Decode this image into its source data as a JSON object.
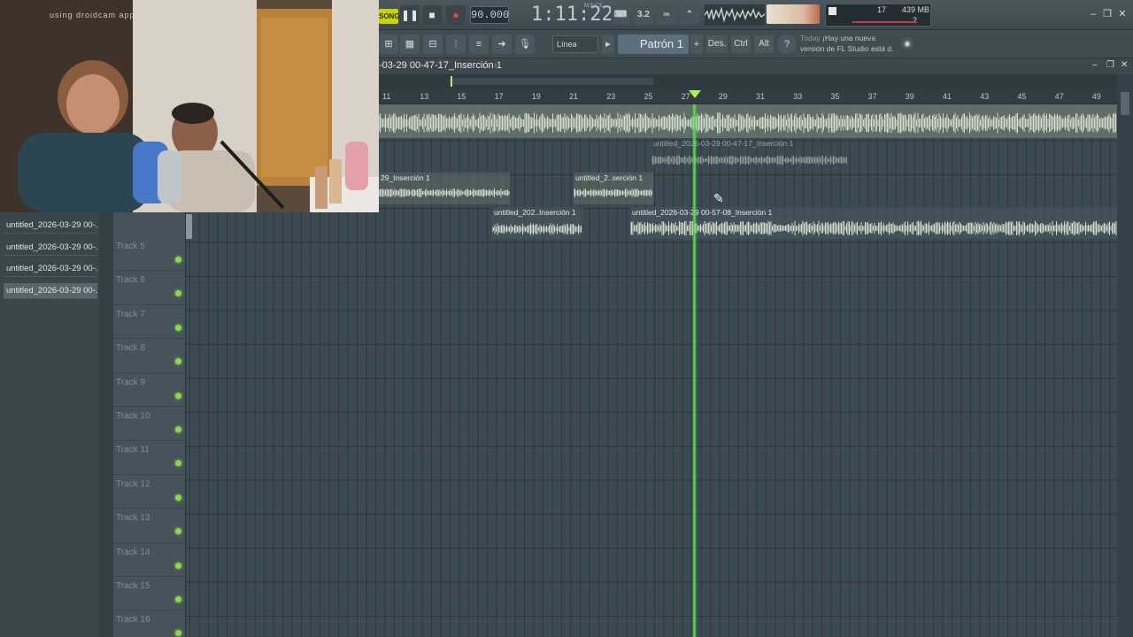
{
  "transport": {
    "song_label": "SONG",
    "tempo": "90.000",
    "time": "1:11:22",
    "time_unit": "M:S:CS",
    "cpu_value": "17",
    "memory": "439 MB",
    "voices": "2"
  },
  "toolbar": {
    "snap_label": "Línea",
    "pattern_label": "Patrón 1",
    "desc_label": "Des.",
    "ctrl_label": "Ctrl",
    "alt_label": "Alt",
    "news_today": "Today",
    "news_line1": "¡Hay una nueva",
    "news_line2": "versión de FL Studio está d."
  },
  "playlist": {
    "title": "-03-29 00-47-17_Inserción 1",
    "ruler_ticks": [
      "11",
      "13",
      "15",
      "17",
      "19",
      "21",
      "23",
      "25",
      "27",
      "29",
      "31",
      "33",
      "35",
      "37",
      "39",
      "41",
      "43",
      "45",
      "47",
      "49"
    ]
  },
  "clips": [
    {
      "label": "untitled_2026-03-29 00-47-17_Inserción 1"
    },
    {
      "label": "29_Inserción 1"
    },
    {
      "label": "untitled_2..serción 1"
    },
    {
      "label": "untitled_202..Inserción 1"
    },
    {
      "label": "untitled_2026-03-29 00-57-08_Inserción 1"
    }
  ],
  "tracks": [
    "Track 5",
    "Track 6",
    "Track 7",
    "Track 8",
    "Track 9",
    "Track 10",
    "Track 11",
    "Track 12",
    "Track 13",
    "Track 14",
    "Track 15",
    "Track 16"
  ],
  "browser": {
    "items": [
      "untitled_2026-03-29 00-...",
      "untitled_2026-03-29 00-...",
      "untitled_2026-03-29 00-...",
      "untitled_2026-03-29 00-..."
    ]
  },
  "webcam": {
    "overlay_text": "using droidcam app"
  },
  "colors": {
    "playhead": "#5ee24a",
    "song_button": "#c8d400",
    "record": "#ff3d3d",
    "waveform": "#c9d6c2"
  }
}
